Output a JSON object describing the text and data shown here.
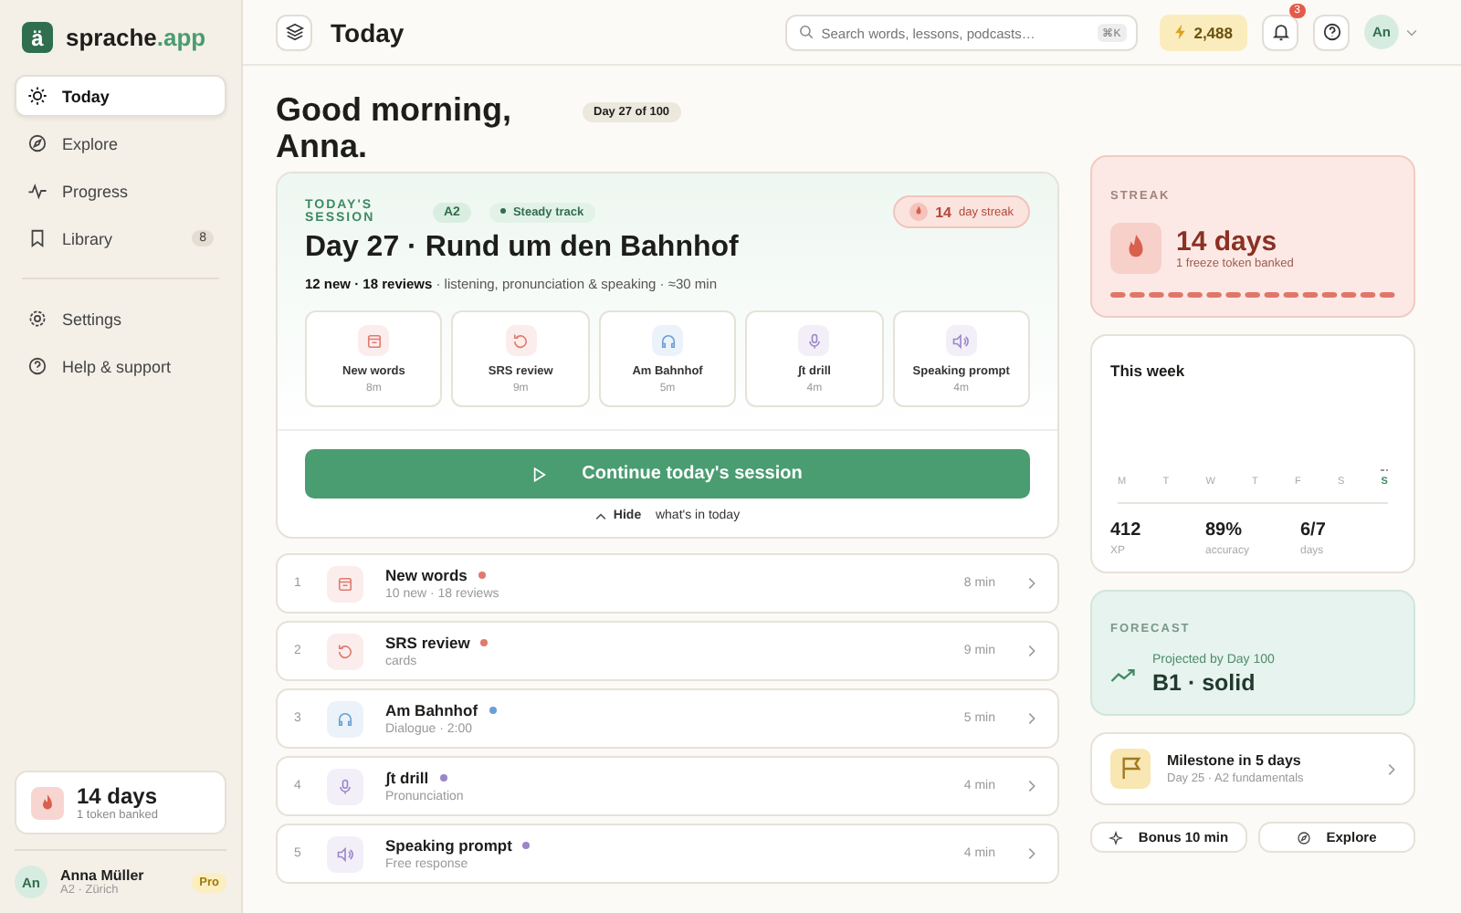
{
  "brand": {
    "logo": "ä",
    "name": "sprache",
    "suffix": ".app"
  },
  "sidebar": {
    "items": [
      {
        "label": "Today",
        "selected": true
      },
      {
        "label": "Explore",
        "selected": false
      },
      {
        "label": "Progress",
        "selected": false
      },
      {
        "label": "Library",
        "selected": false,
        "badge": "8"
      }
    ],
    "footer_items": [
      {
        "label": "Settings",
        "selected": false
      },
      {
        "label": "Help & support",
        "selected": false
      }
    ],
    "streak": {
      "value": "14 days",
      "note": "1 token banked"
    },
    "user": {
      "initials": "An",
      "name": "Anna Müller",
      "meta": "A2 · Zürich",
      "plan": "Pro"
    }
  },
  "header": {
    "title": "Today",
    "search_placeholder": "Search words, lessons, podcasts…",
    "shortcut": "⌘K",
    "xp": "2,488",
    "notifications": "3",
    "avatar": "An"
  },
  "greeting": {
    "text": "Good morning, Anna.",
    "day_badge": "Day 27 of 100"
  },
  "session": {
    "eyebrow": "TODAY'S SESSION",
    "level": "A2",
    "track": "Steady track",
    "streak_value": "14",
    "streak_label": "day streak",
    "title": "Day 27 · Rund um den Bahnhof",
    "summary": "**12 new · 18 reviews** · listening, pronunciation & speaking · ≈30 min",
    "activities": [
      {
        "label": "New words",
        "duration": "8m",
        "color": "#e07a6e"
      },
      {
        "label": "SRS review",
        "duration": "9m",
        "color": "#e07a6e"
      },
      {
        "label": "Am Bahnhof",
        "duration": "5m",
        "color": "#6a9fd4"
      },
      {
        "label": "ʃt drill",
        "duration": "4m",
        "color": "#9a86c9"
      },
      {
        "label": "Speaking prompt",
        "duration": "4m",
        "color": "#9a86c9"
      }
    ],
    "continue_button": "Continue today's session",
    "toggle": {
      "action": "Hide",
      "label": "what's in today",
      "expanded": true
    }
  },
  "plan": [
    {
      "number": "1",
      "title": "New words",
      "subtitle": "10 new · 18 reviews",
      "duration": "8 min",
      "color": "#e07a6e"
    },
    {
      "number": "2",
      "title": "SRS review",
      "subtitle": "cards",
      "duration": "9 min",
      "color": "#e07a6e"
    },
    {
      "number": "3",
      "title": "Am Bahnhof",
      "subtitle": "Dialogue · 2:00",
      "duration": "5 min",
      "color": "#6a9fd4"
    },
    {
      "number": "4",
      "title": "ʃt drill",
      "subtitle": "Pronunciation",
      "duration": "4 min",
      "color": "#9a86c9"
    },
    {
      "number": "5",
      "title": "Speaking prompt",
      "subtitle": "Free response",
      "duration": "4 min",
      "color": "#9a86c9"
    }
  ],
  "streak_card": {
    "label": "STREAK",
    "value": "14 days",
    "note": "1 freeze token banked"
  },
  "week": {
    "title": "This week",
    "days": [
      {
        "label": "M",
        "selected": false
      },
      {
        "label": "T",
        "selected": false
      },
      {
        "label": "W",
        "selected": false
      },
      {
        "label": "T",
        "selected": false
      },
      {
        "label": "F",
        "selected": false
      },
      {
        "label": "S",
        "selected": false
      },
      {
        "label": "S",
        "selected": true
      }
    ],
    "stats": [
      {
        "value": "412",
        "label": "XP"
      },
      {
        "value": "89%",
        "label": "accuracy"
      },
      {
        "value": "6/7",
        "label": "days"
      }
    ]
  },
  "forecast": {
    "label": "FORECAST",
    "caption": "Projected by Day 100",
    "value": "B1 · solid"
  },
  "milestone": {
    "title": "Milestone in 5 days",
    "subtitle": "Day 25 · A2 fundamentals"
  },
  "actions": [
    "Bonus 10 min",
    "Explore"
  ]
}
